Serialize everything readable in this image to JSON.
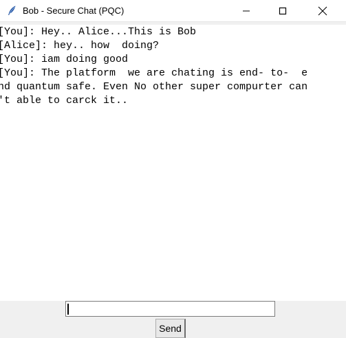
{
  "window": {
    "title": "Bob - Secure Chat (PQC)",
    "icons": {
      "app": "feather-icon",
      "minimize": "minimize-icon",
      "maximize": "maximize-icon",
      "close": "close-icon"
    }
  },
  "chat": {
    "lines": [
      "[You]: Hey.. Alice...This is Bob",
      "[Alice]: hey.. how  doing?",
      "[You]: iam doing good",
      "[You]: The platform  we are chating is end- to-  e",
      "nd quantum safe. Even No other super compurter can",
      "'t able to carck it.."
    ]
  },
  "input": {
    "value": "",
    "placeholder": ""
  },
  "send_button": {
    "label": "Send"
  }
}
